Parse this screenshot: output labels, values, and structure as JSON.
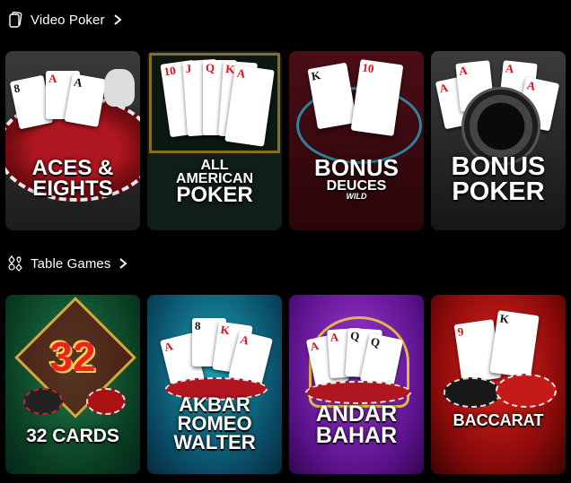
{
  "sections": [
    {
      "title": "Video Poker",
      "icon": "cards-icon",
      "games": [
        {
          "id": "aces-eights",
          "lines": [
            "ACES &",
            "EIGHTS"
          ]
        },
        {
          "id": "all-american",
          "lines": [
            "ALL",
            "AMERICAN",
            "POKER"
          ]
        },
        {
          "id": "bonus-deuces",
          "lines": [
            "BONUS",
            "DEUCES",
            "WILD"
          ]
        },
        {
          "id": "bonus-poker",
          "lines": [
            "BONUS",
            "POKER"
          ]
        }
      ]
    },
    {
      "title": "Table Games",
      "icon": "card-suits-icon",
      "games": [
        {
          "id": "32-cards",
          "badge": "32",
          "lines": [
            "32 CARDS"
          ]
        },
        {
          "id": "akbar-romeo-walter",
          "lines": [
            "AKBAR",
            "ROMEO",
            "WALTER"
          ]
        },
        {
          "id": "andar-bahar",
          "lines": [
            "ANDAR",
            "BAHAR"
          ]
        },
        {
          "id": "baccarat",
          "lines": [
            "BACCARAT"
          ]
        }
      ]
    }
  ],
  "card_ranks": {
    "ace": "A",
    "eight": "8",
    "ten": "10",
    "king": "K",
    "queen": "Q",
    "jack": "J",
    "nine": "9"
  },
  "colors": {
    "background": "#000000",
    "text": "#ffffff",
    "accent_red": "#d8141a"
  }
}
